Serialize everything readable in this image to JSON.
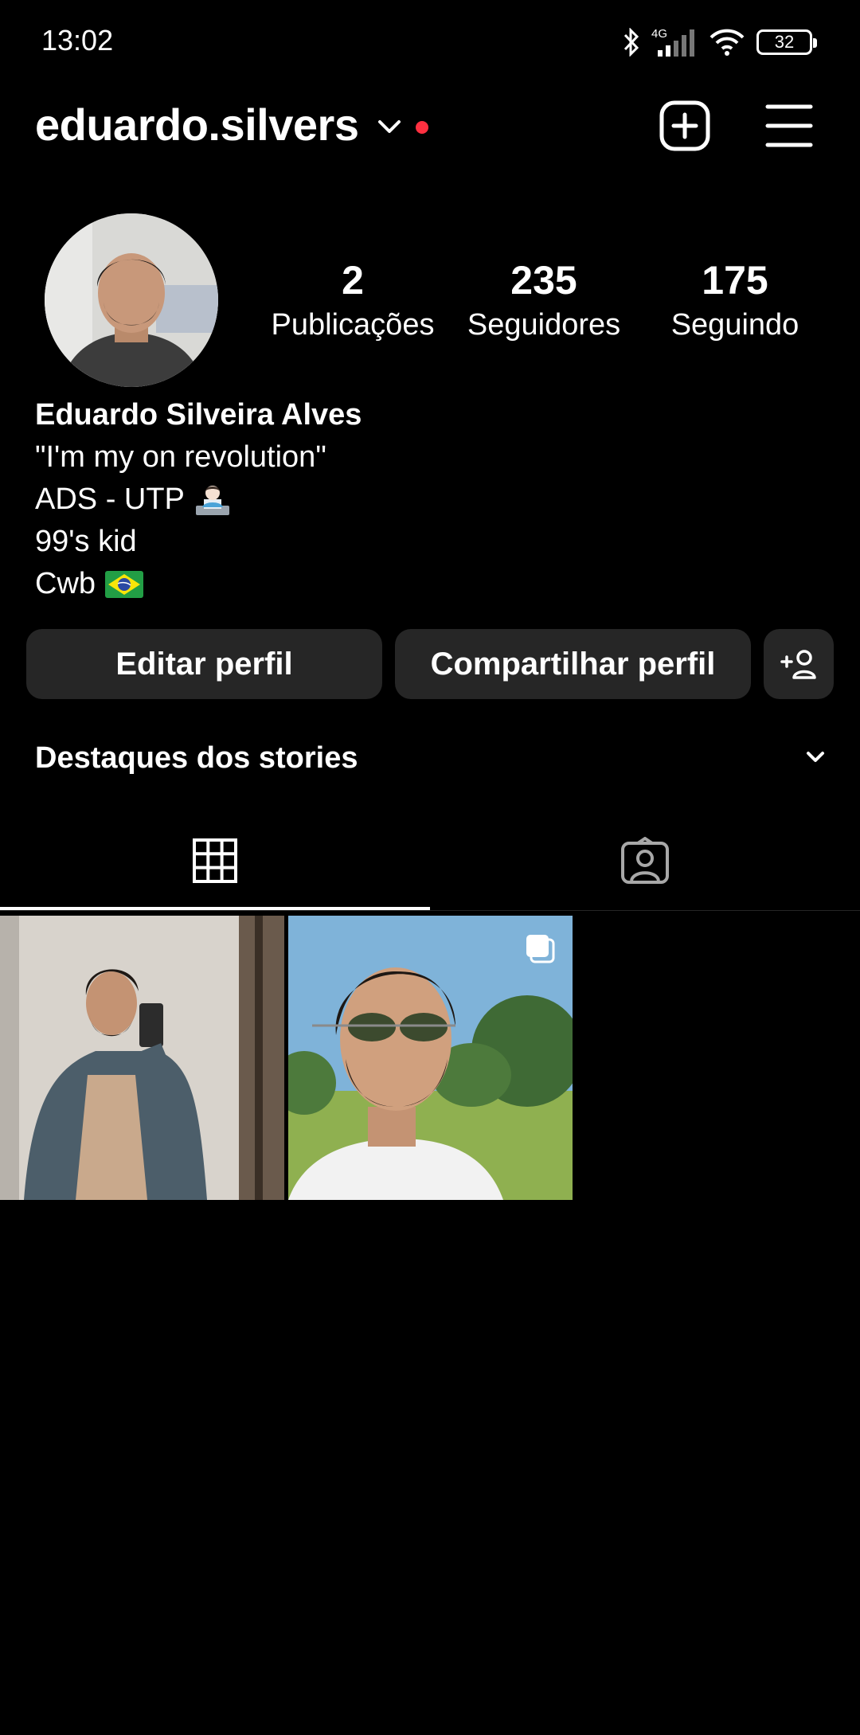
{
  "status_bar": {
    "time": "13:02",
    "network": "4G",
    "battery": "32"
  },
  "header": {
    "username": "eduardo.silvers",
    "icons": [
      "chevron-down-icon",
      "notification-dot",
      "new-post-icon",
      "menu-icon"
    ]
  },
  "profile": {
    "stats": [
      {
        "value": "2",
        "label": "Publicações"
      },
      {
        "value": "235",
        "label": "Seguidores"
      },
      {
        "value": "175",
        "label": "Seguindo"
      }
    ],
    "full_name": "Eduardo Silveira Alves",
    "bio_lines": [
      "\"I'm my on revolution\"",
      "ADS - UTP",
      "99's kid",
      "Cwb"
    ],
    "bio_emojis": [
      "technologist-emoji",
      "brazil-flag-emoji"
    ]
  },
  "actions": {
    "edit_label": "Editar perfil",
    "share_label": "Compartilhar perfil",
    "add_icon": "add-person-icon"
  },
  "highlights": {
    "title": "Destaques dos stories"
  },
  "tabs": [
    {
      "icon": "grid-icon",
      "active": true
    },
    {
      "icon": "tagged-icon",
      "active": false
    }
  ],
  "posts": [
    {
      "name": "post-mirror-selfie",
      "multi": false
    },
    {
      "name": "post-sunglasses-portrait",
      "multi": true
    }
  ],
  "colors": {
    "background": "#000000",
    "button_bg": "#262626",
    "notification": "#ff3040",
    "text": "#ffffff"
  }
}
